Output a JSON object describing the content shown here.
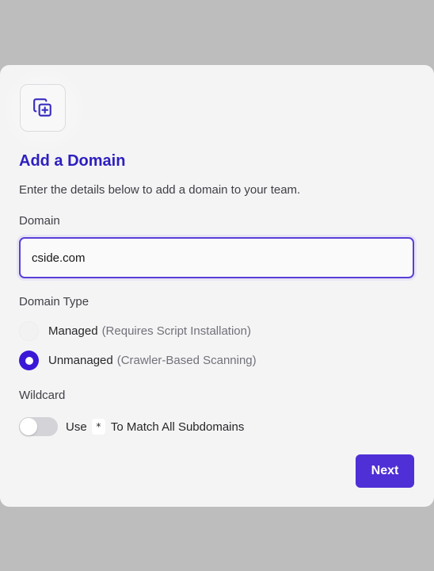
{
  "modal": {
    "title": "Add a Domain",
    "subtitle": "Enter the details below to add a domain to your team.",
    "icon": "copy-plus-icon"
  },
  "domain_field": {
    "label": "Domain",
    "value": "cside.com"
  },
  "domain_type": {
    "label": "Domain Type",
    "selected": "Unmanaged",
    "options": [
      {
        "label": "Managed",
        "hint": "(Requires Script Installation)",
        "checked": false
      },
      {
        "label": "Unmanaged",
        "hint": "(Crawler-Based Scanning)",
        "checked": true
      }
    ]
  },
  "wildcard": {
    "label": "Wildcard",
    "toggle_on": false,
    "text_before": "Use",
    "code": "*",
    "text_after": "To Match All Subdomains"
  },
  "actions": {
    "next_label": "Next"
  },
  "colors": {
    "accent": "#4f2fd6",
    "title": "#2d1fbf",
    "backdrop": "#bdbdbd",
    "panel": "#f4f4f5"
  }
}
